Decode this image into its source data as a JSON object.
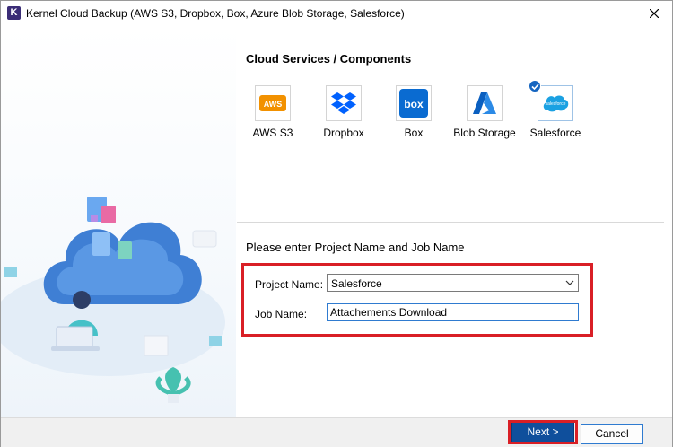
{
  "window": {
    "title": "Kernel Cloud Backup (AWS S3, Dropbox, Box, Azure Blob Storage, Salesforce)",
    "app_icon_letter": "K"
  },
  "services_section": {
    "title": "Cloud Services / Components",
    "items": [
      {
        "label": "AWS S3",
        "icon": "aws-icon",
        "selected": false
      },
      {
        "label": "Dropbox",
        "icon": "dropbox-icon",
        "selected": false
      },
      {
        "label": "Box",
        "icon": "box-icon",
        "selected": false
      },
      {
        "label": "Blob Storage",
        "icon": "azure-icon",
        "selected": false
      },
      {
        "label": "Salesforce",
        "icon": "salesforce-icon",
        "selected": true
      }
    ],
    "aws_icon_text": "AWS",
    "box_icon_text": "box",
    "salesforce_icon_text": "salesforce"
  },
  "form": {
    "prompt": "Please enter Project Name and Job Name",
    "project_name_label": "Project Name:",
    "project_name_value": "Salesforce",
    "job_name_label": "Job Name:",
    "job_name_value": "Attachements Download"
  },
  "footer": {
    "next_label": "Next >",
    "cancel_label": "Cancel"
  },
  "colors": {
    "highlight": "#d91f26",
    "next_button": "#0f4f9c",
    "selected_badge": "#1565c0"
  }
}
